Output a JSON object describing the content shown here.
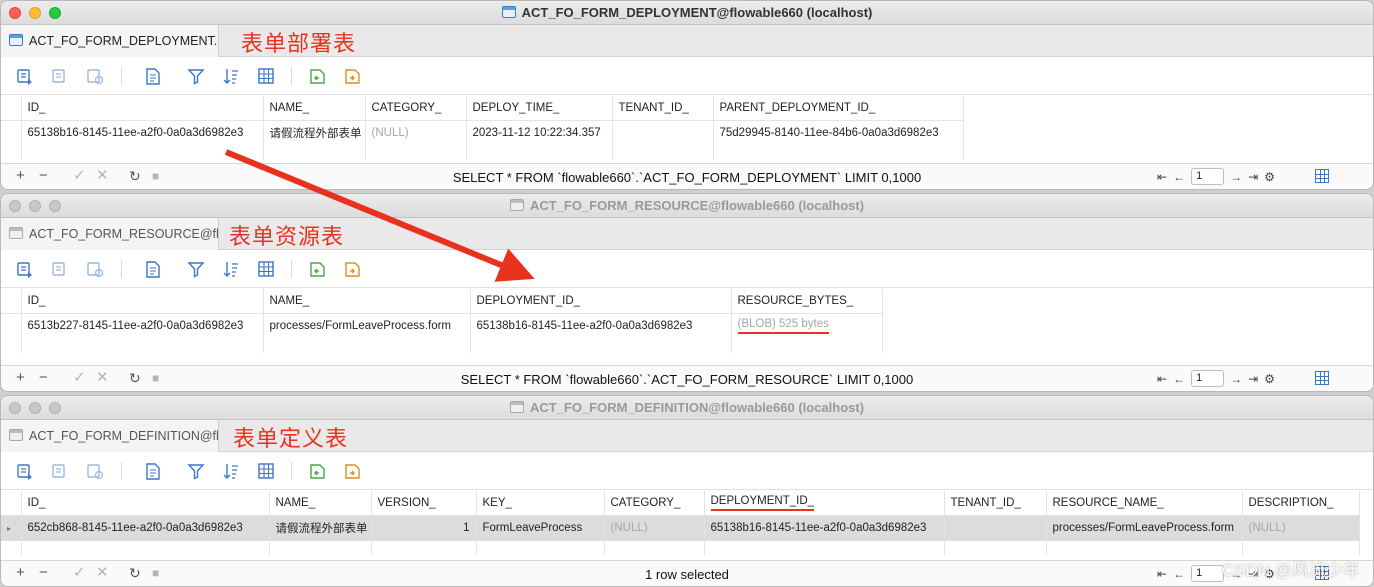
{
  "window1": {
    "title": "ACT_FO_FORM_DEPLOYMENT@flowable660 (localhost)",
    "tab_label": "ACT_FO_FORM_DEPLOYMENT...",
    "annotation": "表单部署表",
    "columns": [
      "ID_",
      "NAME_",
      "CATEGORY_",
      "DEPLOY_TIME_",
      "TENANT_ID_",
      "PARENT_DEPLOYMENT_ID_"
    ],
    "rows": [
      [
        "65138b16-8145-11ee-a2f0-0a0a3d6982e3",
        "请假流程外部表单",
        "(NULL)",
        "2023-11-12 10:22:34.357",
        "",
        "75d29945-8140-11ee-84b6-0a0a3d6982e3"
      ]
    ],
    "status_text": "SELECT * FROM `flowable660`.`ACT_FO_FORM_DEPLOYMENT` LIMIT 0,1000",
    "page": "1"
  },
  "window2": {
    "title": "ACT_FO_FORM_RESOURCE@flowable660 (localhost)",
    "tab_label": "ACT_FO_FORM_RESOURCE@fl...",
    "annotation": "表单资源表",
    "columns": [
      "ID_",
      "NAME_",
      "DEPLOYMENT_ID_",
      "RESOURCE_BYTES_"
    ],
    "rows": [
      [
        "6513b227-8145-11ee-a2f0-0a0a3d6982e3",
        "processes/FormLeaveProcess.form",
        "65138b16-8145-11ee-a2f0-0a0a3d6982e3",
        "(BLOB) 525 bytes"
      ]
    ],
    "status_text": "SELECT * FROM `flowable660`.`ACT_FO_FORM_RESOURCE` LIMIT 0,1000",
    "page": "1"
  },
  "window3": {
    "title": "ACT_FO_FORM_DEFINITION@flowable660 (localhost)",
    "tab_label": "ACT_FO_FORM_DEFINITION@fl...",
    "annotation": "表单定义表",
    "columns": [
      "ID_",
      "NAME_",
      "VERSION_",
      "KEY_",
      "CATEGORY_",
      "DEPLOYMENT_ID_",
      "TENANT_ID_",
      "RESOURCE_NAME_",
      "DESCRIPTION_"
    ],
    "rows": [
      [
        "652cb868-8145-11ee-a2f0-0a0a3d6982e3",
        "请假流程外部表单",
        "1",
        "FormLeaveProcess",
        "(NULL)",
        "65138b16-8145-11ee-a2f0-0a0a3d6982e3",
        "",
        "processes/FormLeaveProcess.form",
        "(NULL)"
      ]
    ],
    "status_text": "1 row selected",
    "page": "1"
  },
  "watermark": "CSDN @风流少年",
  "colors": {
    "annotation": "#e8321e",
    "accent": "#3a76c4"
  }
}
